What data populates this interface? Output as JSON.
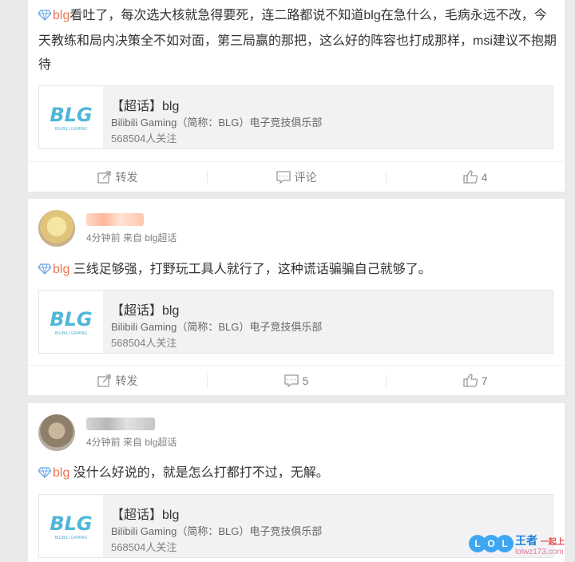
{
  "posts": [
    {
      "text": "看吐了，每次选大核就急得要死，连二路都说不知道blg在急什么，毛病永远不改，今天教练和局内决策全不如对面，第三局赢的那把，这么好的阵容也打成那样，msi建议不抱期待",
      "topic": "blg",
      "actions": {
        "repost": "转发",
        "comment": "评论",
        "like": "4"
      }
    },
    {
      "time": "4分钟前",
      "source": "来自 blg超话",
      "text": " 三线足够强，打野玩工具人就行了，这种谎话骗骗自己就够了。",
      "topic": "blg",
      "actions": {
        "repost": "转发",
        "comment": "5",
        "like": "7"
      }
    },
    {
      "time": "4分钟前",
      "source": "来自 blg超话",
      "text": " 没什么好说的，就是怎么打都打不过，无解。",
      "topic": "blg"
    }
  ],
  "share_card": {
    "title": "【超话】blg",
    "description": "Bilibili Gaming（简称：BLG）电子竞技俱乐部",
    "followers": "568504人关注",
    "logo_text": "BLG",
    "logo_subtext": "BILIBILI GAMING"
  },
  "watermark": {
    "letters": [
      "L",
      "O",
      "L"
    ],
    "title": "王者",
    "tag": "一起上",
    "url": "lolwz173.com"
  },
  "colors": {
    "topic": "#eb7350",
    "logo_blue": "#4fb7d9",
    "watermark_blue": "#3fa6f2"
  },
  "icons": [
    "diamond-icon",
    "repost-icon",
    "comment-icon",
    "like-icon"
  ]
}
